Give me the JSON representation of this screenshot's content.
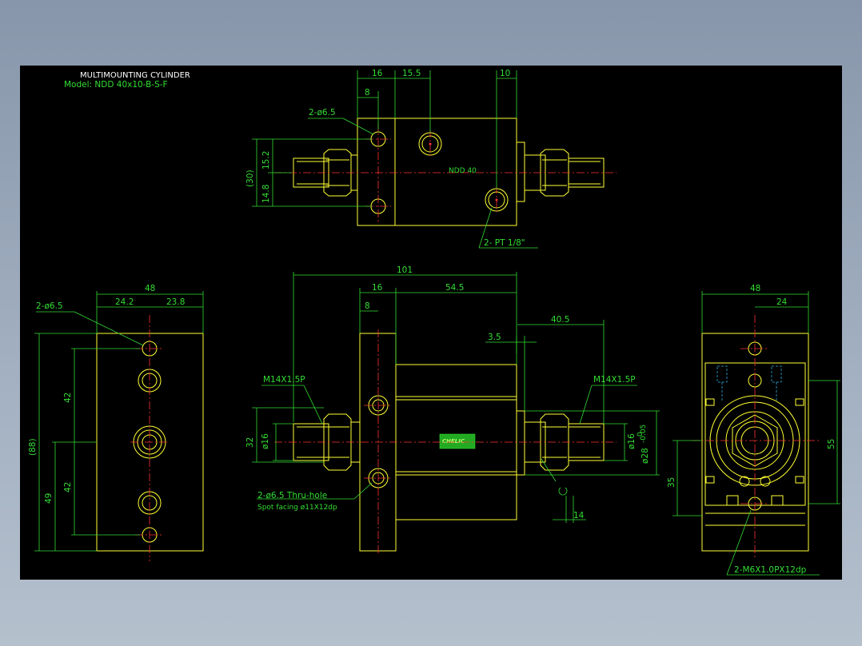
{
  "title": {
    "line1": "MULTIMOUNTING CYLINDER",
    "line2": "Model: NDD 40x10-B-S-F"
  },
  "colors": {
    "background": "#000000",
    "geometry": "#ffff33",
    "dimension": "#33dd33",
    "centerline": "#ff3333",
    "hidden": "#33aadd",
    "title": "#ffffff"
  },
  "top_view": {
    "dims": {
      "d16": "16",
      "d15_5": "15.5",
      "d10": "10",
      "d8": "8",
      "d15_2": "15.2",
      "d14_8": "14.8",
      "d30": "(30)"
    },
    "callouts": {
      "holes": "2-ø6.5",
      "ports": "2- PT 1/8\"",
      "body_mark": "NDD 40"
    }
  },
  "front_view": {
    "dims": {
      "d101": "101",
      "d16": "16",
      "d54_5": "54.5",
      "d8": "8",
      "d40_5": "40.5",
      "d3_5": "3.5",
      "d32": "32",
      "d16_left": "ø16",
      "d16_right": "ø16",
      "d28": "ø28",
      "tol_upper": "0",
      "tol_lower": "-0.05",
      "d14": "14"
    },
    "callouts": {
      "thread_left": "M14X1.5P",
      "thread_right": "M14X1.5P",
      "holes": "2-ø6.5 Thru-hole",
      "spot": "Spot facing  ø11X12dp",
      "label": "CHELIC"
    }
  },
  "left_view": {
    "dims": {
      "d48": "48",
      "d24_2": "24.2",
      "d23_8": "23.8",
      "d42a": "42",
      "d42b": "42",
      "d49": "49",
      "d88": "(88)"
    },
    "callouts": {
      "holes": "2-ø6.5"
    }
  },
  "right_view": {
    "dims": {
      "d48": "48",
      "d24": "24",
      "d55": "55",
      "d35": "35"
    },
    "callouts": {
      "tapped": "2-M6X1.0PX12dp"
    }
  }
}
